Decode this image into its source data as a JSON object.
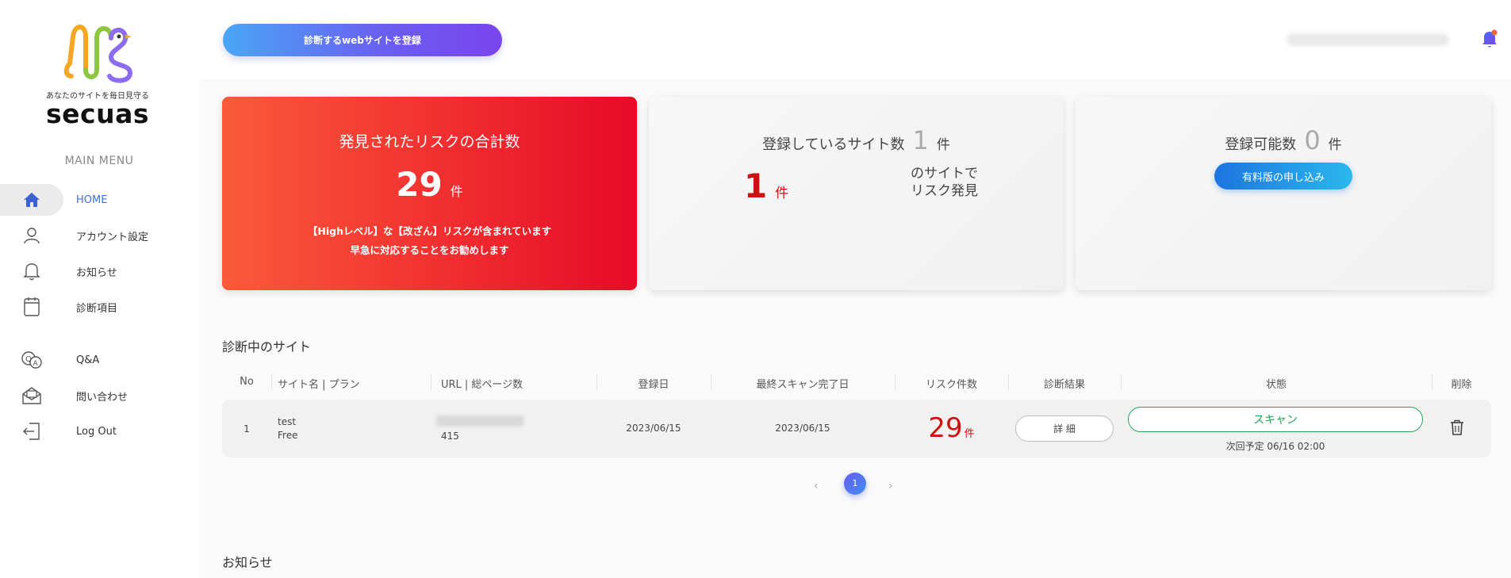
{
  "brand": {
    "tagline": "あなたのサイトを毎日見守る",
    "name": "secuas",
    "colors": {
      "logo_green": "#8dc63f",
      "logo_orange": "#f5a623",
      "logo_purple": "#8e6cf0",
      "logo_blue": "#3d7ff0"
    }
  },
  "sidebar": {
    "heading": "MAIN MENU",
    "items": [
      {
        "label": "HOME",
        "icon": "home-icon",
        "active": true
      },
      {
        "label": "アカウント設定",
        "icon": "user-icon"
      },
      {
        "label": "お知らせ",
        "icon": "bell-icon"
      },
      {
        "label": "診断項目",
        "icon": "notepad-icon"
      },
      {
        "label": "Q&A",
        "icon": "qa-icon"
      },
      {
        "label": "問い合わせ",
        "icon": "mail-icon"
      },
      {
        "label": "Log Out",
        "icon": "logout-icon"
      }
    ]
  },
  "topbar": {
    "register_button": "診断するwebサイトを登録",
    "notification_icon": "bell-icon"
  },
  "cards": {
    "risk": {
      "title": "発見されたリスクの合計数",
      "count": "29",
      "unit": "件",
      "note_line1": "【Highレベル】な【改ざん】リスクが含まれています",
      "note_line2": "早急に対応することをお勧めします",
      "colors": {
        "from": "#fb5a3a",
        "to": "#e70a27"
      }
    },
    "sites": {
      "title": "登録しているサイト数",
      "count": "1",
      "unit": "件",
      "risk_count": "1",
      "risk_unit": "件",
      "note": "のサイトで\nリスク発見"
    },
    "available": {
      "title": "登録可能数",
      "count": "0",
      "unit": "件",
      "button": "有料版の申し込み"
    }
  },
  "table": {
    "title": "診断中のサイト",
    "columns": [
      "No",
      "サイト名 | プラン",
      "URL | 総ページ数",
      "登録日",
      "最終スキャン完了日",
      "リスク件数",
      "診断結果",
      "状態",
      "削除"
    ],
    "rows": [
      {
        "no": "1",
        "site_name": "test",
        "plan": "Free",
        "pages": "415",
        "registered": "2023/06/15",
        "last_scan": "2023/06/15",
        "risk_count": "29",
        "risk_unit": "件",
        "detail_button": "詳 細",
        "scan_button": "スキャン",
        "next_scan": "次回予定 06/16 02:00"
      }
    ]
  },
  "pagination": {
    "prev": "‹",
    "current": "1",
    "next": "›"
  },
  "news": {
    "title": "お知らせ"
  }
}
